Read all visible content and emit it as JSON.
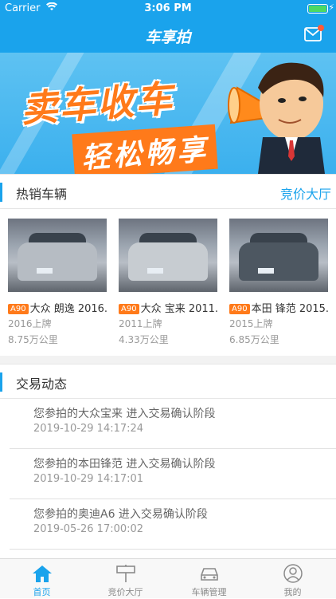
{
  "status_bar": {
    "carrier": "Carrier",
    "time": "3:06 PM"
  },
  "nav": {
    "title": "车享拍",
    "mail_icon": "mail-icon"
  },
  "banner": {
    "headline": "卖车收车",
    "subline": "轻松畅享"
  },
  "hot_section": {
    "title": "热销车辆",
    "link": "竞价大厅"
  },
  "cars": [
    {
      "badge": "A90",
      "name": "大众 朗逸 2016...",
      "registered": "2016上牌",
      "mileage": "8.75万公里",
      "color": "#b6bcc3"
    },
    {
      "badge": "A90",
      "name": "大众 宝来 2011...",
      "registered": "2011上牌",
      "mileage": "4.33万公里",
      "color": "#c7ccd1"
    },
    {
      "badge": "A90",
      "name": "本田 锋范 2015...",
      "registered": "2015上牌",
      "mileage": "6.85万公里",
      "color": "#4d5761"
    }
  ],
  "trade_section": {
    "title": "交易动态"
  },
  "feed": [
    {
      "text": "您参拍的大众宝来 进入交易确认阶段",
      "time": "2019-10-29 14:17:24"
    },
    {
      "text": "您参拍的本田锋范 进入交易确认阶段",
      "time": "2019-10-29 14:17:01"
    },
    {
      "text": "您参拍的奥迪A6 进入交易确认阶段",
      "time": "2019-05-26 17:00:02"
    }
  ],
  "tabs": [
    {
      "label": "首页",
      "icon": "home-icon",
      "active": true
    },
    {
      "label": "竞价大厅",
      "icon": "auction-sign-icon",
      "active": false
    },
    {
      "label": "车辆管理",
      "icon": "car-icon",
      "active": false
    },
    {
      "label": "我的",
      "icon": "user-icon",
      "active": false
    }
  ],
  "colors": {
    "primary": "#1aa3ec",
    "accent": "#ff7a1a",
    "text": "#333333",
    "muted": "#999999"
  }
}
